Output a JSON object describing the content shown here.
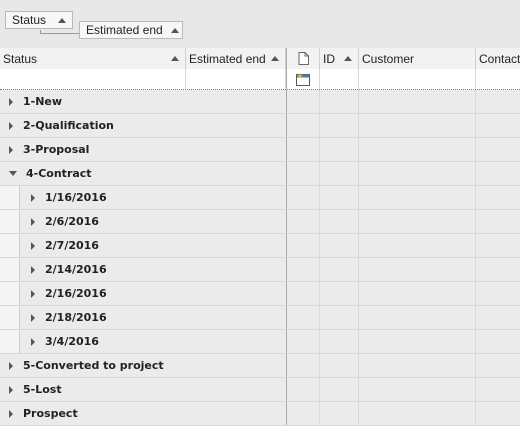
{
  "group_panel": {
    "chips": [
      {
        "label": "Status"
      },
      {
        "label": "Estimated end"
      }
    ]
  },
  "columns": [
    {
      "label": "Status",
      "sortable": true
    },
    {
      "label": "Estimated end",
      "sortable": true
    },
    {
      "label": "",
      "icon": "document-icon"
    },
    {
      "label": "ID",
      "sortable": true
    },
    {
      "label": "Customer"
    },
    {
      "label": "Contact"
    }
  ],
  "filter": {
    "new_row_icon": "new-row-icon"
  },
  "groups": [
    {
      "label": "1-New",
      "expanded": false,
      "level": 0
    },
    {
      "label": "2-Qualification",
      "expanded": false,
      "level": 0
    },
    {
      "label": "3-Proposal",
      "expanded": false,
      "level": 0
    },
    {
      "label": "4-Contract",
      "expanded": true,
      "level": 0
    },
    {
      "label": "1/16/2016",
      "expanded": false,
      "level": 1
    },
    {
      "label": "2/6/2016",
      "expanded": false,
      "level": 1
    },
    {
      "label": "2/7/2016",
      "expanded": false,
      "level": 1
    },
    {
      "label": "2/14/2016",
      "expanded": false,
      "level": 1
    },
    {
      "label": "2/16/2016",
      "expanded": false,
      "level": 1
    },
    {
      "label": "2/18/2016",
      "expanded": false,
      "level": 1
    },
    {
      "label": "3/4/2016",
      "expanded": false,
      "level": 1
    },
    {
      "label": "5-Converted to project",
      "expanded": false,
      "level": 0
    },
    {
      "label": "5-Lost",
      "expanded": false,
      "level": 0
    },
    {
      "label": "Prospect",
      "expanded": false,
      "level": 0
    }
  ]
}
